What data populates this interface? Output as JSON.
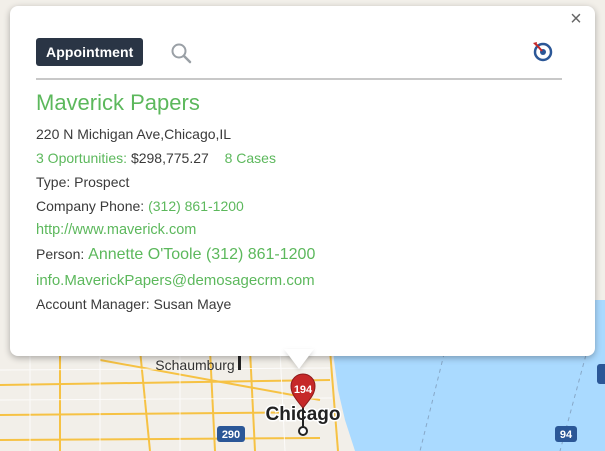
{
  "toolbar": {
    "appointment_label": "Appointment",
    "search_icon": "search-icon",
    "target_icon": "target-icon",
    "close_label": "×"
  },
  "company": {
    "name": "Maverick Papers",
    "address": "220 N Michigan Ave,Chicago,IL",
    "opportunities_label": "3 Oportunities:",
    "opportunities_value": "$298,775.27",
    "cases": "8 Cases",
    "type": "Type: Prospect",
    "phone_label": "Company Phone:",
    "phone": "(312) 861-1200",
    "website": "http://www.maverick.com",
    "person_label": "Person:",
    "person": "Annette O'Toole (312) 861-1200",
    "email": "info.MaverickPapers@demosagecrm.com",
    "account_manager": "Account Manager: Susan Maye"
  },
  "map": {
    "city_label": "Chicago",
    "suburb_label": "Schaumburg",
    "marker_count": "194",
    "highway_290": "290",
    "highway_94": "94"
  },
  "colors": {
    "green": "#5cb85c",
    "button_bg": "#2a3545",
    "marker": "#c62828",
    "water": "#aadaff",
    "land": "#f2efe9"
  }
}
